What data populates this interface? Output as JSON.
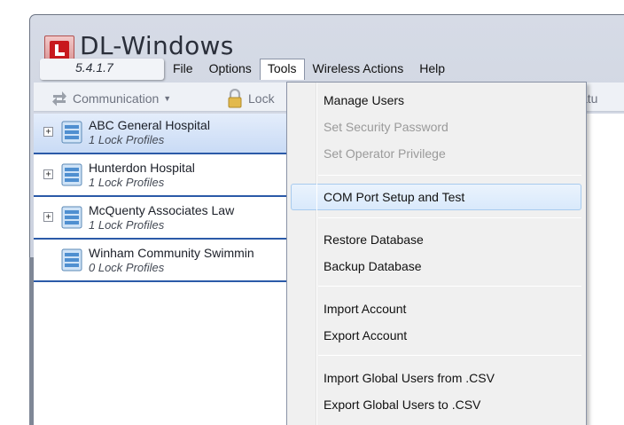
{
  "app": {
    "title": "DL-Windows",
    "version": "5.4.1.7"
  },
  "menubar": {
    "items": [
      {
        "label": "File"
      },
      {
        "label": "Options"
      },
      {
        "label": "Tools",
        "open": true
      },
      {
        "label": "Wireless Actions"
      },
      {
        "label": "Help"
      }
    ]
  },
  "toolbar": {
    "communication_label": "Communication",
    "lock_label": "Lock",
    "partial_label": "atu"
  },
  "tree": {
    "items": [
      {
        "title": "ABC General Hospital",
        "sub": "1 Lock Profiles",
        "expandable": true,
        "selected": true
      },
      {
        "title": "Hunterdon Hospital",
        "sub": "1 Lock Profiles",
        "expandable": true,
        "selected": false
      },
      {
        "title": "McQuenty Associates Law",
        "sub": "1 Lock Profiles",
        "expandable": true,
        "selected": false
      },
      {
        "title": "Winham Community Swimmin",
        "sub": "0 Lock Profiles",
        "expandable": false,
        "selected": false
      }
    ]
  },
  "tools_menu": {
    "items": [
      {
        "label": "Manage Users",
        "disabled": false
      },
      {
        "label": "Set Security Password",
        "disabled": true
      },
      {
        "label": "Set Operator Privilege",
        "disabled": true
      },
      {
        "label": "COM Port Setup and Test",
        "disabled": false,
        "highlighted": true
      },
      {
        "label": "Restore Database",
        "disabled": false
      },
      {
        "label": "Backup Database",
        "disabled": false
      },
      {
        "label": "Import Account",
        "disabled": false
      },
      {
        "label": "Export Account",
        "disabled": false
      },
      {
        "label": "Import Global Users from .CSV",
        "disabled": false
      },
      {
        "label": "Export Global Users to .CSV",
        "disabled": false
      }
    ]
  },
  "colors": {
    "accent": "#2b5aa8",
    "logo_red": "#c8191d",
    "highlight": "#d9e9fb"
  }
}
